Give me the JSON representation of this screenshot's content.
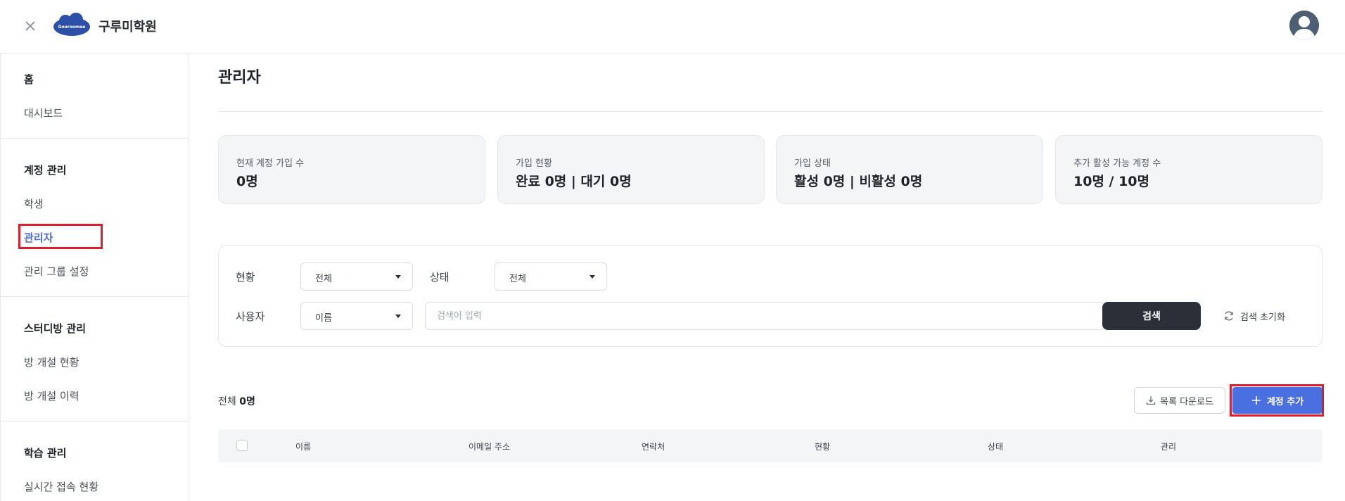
{
  "header": {
    "academy_name": "구루미학원",
    "logo_text": "Gooroomee"
  },
  "sidebar": {
    "sections": [
      {
        "title": "홈",
        "items": [
          "대시보드"
        ]
      },
      {
        "title": "계정 관리",
        "items": [
          "학생",
          "관리자",
          "관리 그룹 설정"
        ]
      },
      {
        "title": "스터디방 관리",
        "items": [
          "방 개설 현황",
          "방 개설 이력"
        ]
      },
      {
        "title": "학습 관리",
        "items": [
          "실시간 접속 현황"
        ]
      }
    ],
    "active_item": "관리자"
  },
  "page": {
    "title": "관리자"
  },
  "stats": [
    {
      "label": "현재 계정 가입 수",
      "value": "0명"
    },
    {
      "label": "가입 현황",
      "value": "완료 0명 | 대기 0명"
    },
    {
      "label": "가입 상태",
      "value": "활성 0명 | 비활성 0명"
    },
    {
      "label": "추가 활성 가능 계정 수",
      "value": "10명 / 10명"
    }
  ],
  "filters": {
    "status_label": "현황",
    "status_value": "전체",
    "state_label": "상태",
    "state_value": "전체",
    "user_label": "사용자",
    "user_field_value": "이름",
    "search_placeholder": "검색어 입력",
    "search_button": "검색",
    "reset_button": "검색 초기화"
  },
  "list": {
    "total_prefix": "전체",
    "total_count": "0명",
    "download_button": "목록 다운로드",
    "add_button": "계정 추가",
    "columns": [
      "이름",
      "이메일 주소",
      "연락처",
      "현황",
      "상태",
      "관리"
    ]
  },
  "colors": {
    "accent": "#4a6fe0",
    "active_nav": "#4a6bd8",
    "highlight_frame": "#d91f2e",
    "dark_button": "#2b3038"
  }
}
